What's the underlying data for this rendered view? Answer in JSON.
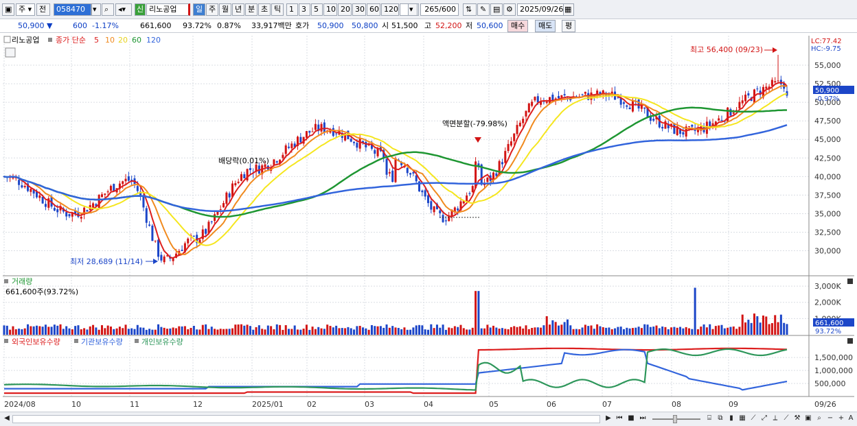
{
  "toolbar": {
    "mode_label": "주",
    "jeon_label": "전",
    "stock_code": "058470",
    "shin_label": "신",
    "stock_name": "리노공업",
    "periods": [
      "일",
      "주",
      "월",
      "년",
      "분",
      "초",
      "틱"
    ],
    "numbers": [
      "1",
      "3",
      "5",
      "10",
      "20",
      "30",
      "60",
      "120"
    ],
    "count_value": "265",
    "count_total": "/600",
    "date": "2025/09/26"
  },
  "infobar": {
    "price": "50,900",
    "change": "600",
    "change_pct": "-1.17%",
    "volume": "661,600",
    "volume_ratio": "93.72%",
    "turnover_pct": "0.87%",
    "amount": "33,917백만",
    "hoga_label": "호가",
    "ask": "50,900",
    "bid": "50,800",
    "open_label": "시",
    "open": "51,500",
    "high_label": "고",
    "high": "52,200",
    "low_label": "저",
    "low": "50,600",
    "buy_label": "매수",
    "sell_label": "매도",
    "eval_label": "평"
  },
  "colors": {
    "up": "#d21414",
    "down": "#1c46c8",
    "ma5": "#dc1e1e",
    "ma10": "#f08a1e",
    "ma20": "#f5e61e",
    "ma60": "#1e9632",
    "ma120": "#3264dc",
    "foreign": "#dc1e1e",
    "institution": "#3264dc",
    "individual": "#2d965a"
  },
  "price_panel": {
    "stock_label": "리노공업",
    "legend_title": "종가 단순",
    "ma_labels": [
      "5",
      "10",
      "20",
      "60",
      "120"
    ],
    "lc": "LC:77.42",
    "hc": "HC:-9.75",
    "current_price": "50,900",
    "current_pct": "-0.97%",
    "high_annotation": "최고 56,400 (09/23)",
    "low_annotation": "최저 28,689 (11/14)",
    "split_annotation": "액면분할(-79.98%)",
    "dividend_annotation": "배당락(0.01%)"
  },
  "volume_panel": {
    "title": "거래량",
    "value_label": "661,600주(93.72%)",
    "axis_ticks": [
      "3,000K",
      "2,000K",
      "1,000K"
    ],
    "current_value": "661,600",
    "current_pct": "93.72%"
  },
  "holding_panel": {
    "legends": [
      "외국인보유수량",
      "기관보유수량",
      "개인보유수량"
    ],
    "axis_ticks": [
      "1,500,000",
      "1,000,000",
      "500,000"
    ]
  },
  "x_axis": {
    "labels": [
      "2024/08",
      "10",
      "11",
      "12",
      "2025/01",
      "02",
      "03",
      "04",
      "05",
      "06",
      "07",
      "08",
      "09",
      "09/26"
    ]
  },
  "chart_data": {
    "type": "candlestick",
    "period": "daily",
    "y_axis_ticks": [
      55000,
      52500,
      50000,
      47500,
      45000,
      42500,
      40000,
      37500,
      35000,
      32500,
      30000
    ],
    "ylim": [
      27000,
      57500
    ],
    "price_keypoints": [
      {
        "month": "2024/08",
        "close": 40000
      },
      {
        "month": "2024/09",
        "close": 35000
      },
      {
        "month": "2024/10",
        "close": 39500
      },
      {
        "month": "2024/11",
        "close": 28689
      },
      {
        "month": "2024/12",
        "close": 31500
      },
      {
        "month": "2025/01",
        "close": 41000
      },
      {
        "month": "2025/02",
        "close": 46500
      },
      {
        "month": "2025/03",
        "close": 42500
      },
      {
        "month": "2025/04",
        "close": 34500
      },
      {
        "month": "2025/05",
        "close": 39000
      },
      {
        "month": "2025/06",
        "close": 50500
      },
      {
        "month": "2025/07",
        "close": 51000
      },
      {
        "month": "2025/08",
        "close": 46000
      },
      {
        "month": "2025/09",
        "close": 52500
      }
    ],
    "high": {
      "value": 56400,
      "date": "09/23"
    },
    "low": {
      "value": 28689,
      "date": "11/14"
    },
    "last": {
      "open": 51500,
      "high": 52200,
      "low": 50600,
      "close": 50900
    },
    "volume_axis_ticks": [
      3000000,
      2000000,
      1000000
    ],
    "holding_axis_ticks": [
      1500000,
      1000000,
      500000
    ]
  }
}
